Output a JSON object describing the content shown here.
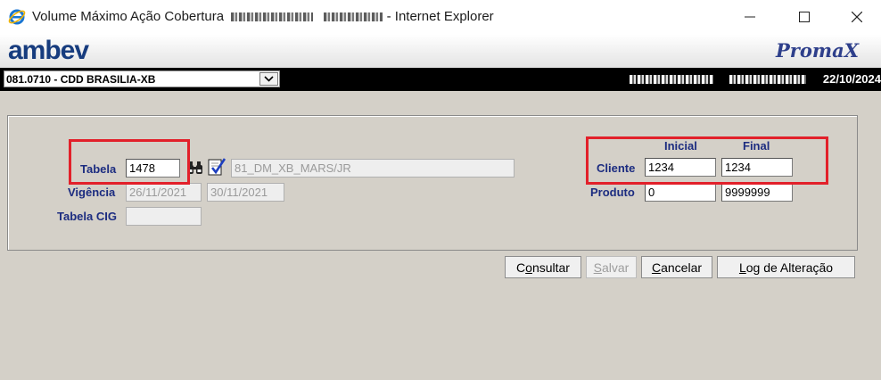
{
  "window": {
    "title_left": "Volume Máximo Ação Cobertura",
    "title_right": "- Internet Explorer"
  },
  "header": {
    "brand": "ambev",
    "product": "PromaX"
  },
  "toolbar": {
    "branch": "081.0710 - CDD BRASILIA-XB",
    "date": "22/10/2024"
  },
  "form": {
    "tabela": {
      "label": "Tabela",
      "value": "1478",
      "description": "81_DM_XB_MARS/JR"
    },
    "vigencia": {
      "label": "Vigência",
      "start": "26/11/2021",
      "end": "30/11/2021"
    },
    "tabela_cig": {
      "label": "Tabela CIG",
      "value": ""
    },
    "range_headers": {
      "initial": "Inicial",
      "final": "Final"
    },
    "cliente": {
      "label": "Cliente",
      "initial": "1234",
      "final": "1234"
    },
    "produto": {
      "label": "Produto",
      "initial": "0",
      "final": "9999999"
    }
  },
  "actions": {
    "consultar_pre": "C",
    "consultar_u": "o",
    "consultar_post": "nsultar",
    "salvar_pre": "",
    "salvar_u": "S",
    "salvar_post": "alvar",
    "cancelar_pre": "",
    "cancelar_u": "C",
    "cancelar_post": "ancelar",
    "log_pre": "",
    "log_u": "L",
    "log_post": "og de Alteração"
  },
  "colors": {
    "label": "#1c2c80",
    "highlight": "#e2202a",
    "brand": "#173c7e"
  }
}
